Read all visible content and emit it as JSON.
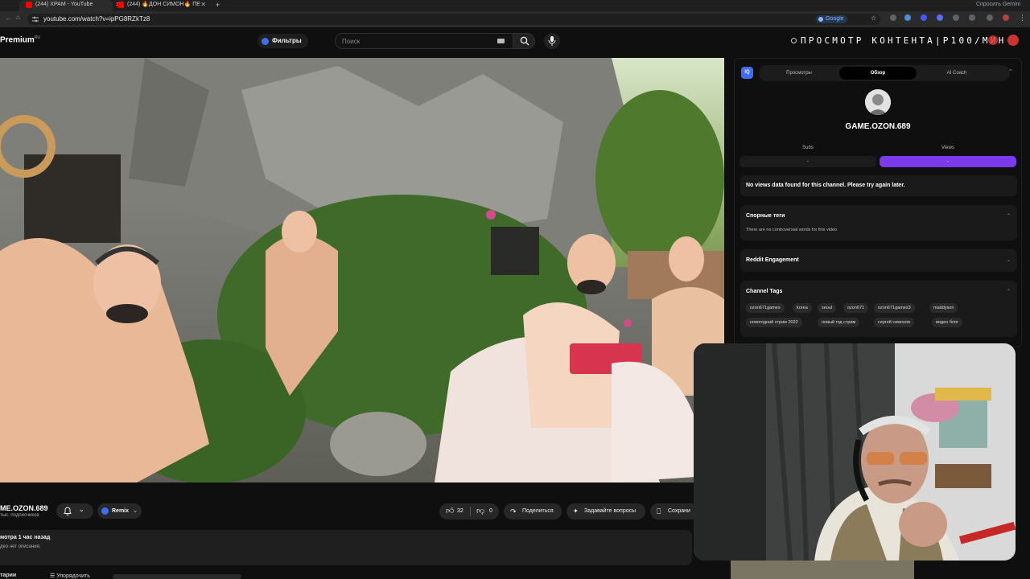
{
  "browser": {
    "tabs": [
      {
        "label": "(244) ХРАМ - YouTube",
        "active": true
      },
      {
        "label": "(244) 🔥ДОН СИМОН🔥 ПЕ",
        "active": false
      }
    ],
    "new_tab": "+",
    "gemini": "Спросить Gemini",
    "url": "youtube.com/watch?v=ipPG8RZkTz8",
    "google_chip": "Google"
  },
  "header": {
    "logo": "Premium",
    "logo_region": "RU",
    "filter_chip": "Фильтры",
    "search_placeholder": "Поиск",
    "overlay_title": "ПРОСМОТР КОНТЕНТА|Р100/МИН"
  },
  "video_info": {
    "channel_name": "ME.OZON.689",
    "subscribers": "тыс. подписчиков",
    "remix_label": "Remix",
    "likes": "32",
    "dislikes": "0",
    "share_label": "Поделиться",
    "ask_label": "Задавайте вопросы",
    "save_label": "Сохрани",
    "desc_line1": "мотра  1 час назад",
    "desc_line2": "део нет описания.",
    "bottom_left": "тарии",
    "bottom_manage": "Упорядочить"
  },
  "panel": {
    "logo": "IQ",
    "tabs": [
      "Просмотры",
      "Обзор",
      "AI Coach"
    ],
    "active_tab": "Обзор",
    "channel_title": "GAME.OZON.689",
    "subs_label": "Subs",
    "views_label": "Views",
    "subs_value": "-",
    "views_value": "-",
    "no_views": "No views data found for this channel. Please try again later.",
    "controversial_title": "Спорные теги",
    "controversial_text": "There are no controversial words for this video",
    "reddit_title": "Reddit Engagement",
    "channel_tags_title": "Channel Tags",
    "tags_row1": [
      "ozon671games",
      "korea",
      "seoul",
      "ozon671",
      "ozon671games3",
      "maddyson"
    ],
    "tags_row2": [
      "новогодний стрим 2022",
      "новый год стрим",
      "сергей симонов",
      "видео блог"
    ]
  },
  "colors": {
    "accent_purple": "#7c3aed",
    "accent_blue": "#3f6ef5",
    "youtube_red": "#ff0000"
  }
}
